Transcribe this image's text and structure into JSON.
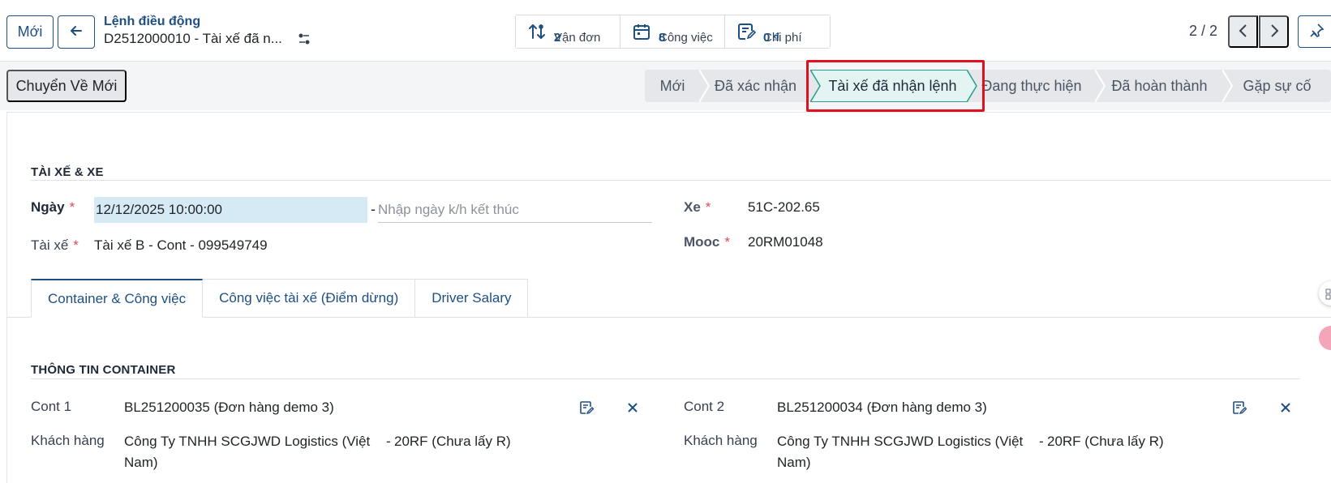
{
  "toolbar": {
    "new_label": "Mới"
  },
  "breadcrumb": {
    "parent": "Lệnh điều động",
    "record": "D2512000010 - Tài xế đã n..."
  },
  "smart_buttons": [
    {
      "label": "Vận đơn",
      "value": "2",
      "icon": "sort-arrows-icon"
    },
    {
      "label": "Công việc",
      "value": "8",
      "icon": "calendar-icon"
    },
    {
      "label": "Chi phí",
      "value": "0 ₫",
      "icon": "edit-note-icon"
    }
  ],
  "pager": {
    "text": "2 / 2"
  },
  "status": {
    "reset_label": "Chuyển Về Mới",
    "stages": [
      "Mới",
      "Đã xác nhận",
      "Tài xế đã nhận lệnh",
      "Đang thực hiện",
      "Đã hoàn thành",
      "Gặp sự cố"
    ],
    "active_stage": "Tài xế đã nhận lệnh"
  },
  "driver_section": {
    "title": "TÀI XẾ & XE",
    "date_label": "Ngày",
    "date_value": "12/12/2025 10:00:00",
    "date_end_placeholder": "Nhập ngày k/h kết thúc",
    "driver_label": "Tài xế",
    "driver_value": "Tài xế B - Cont - 099549749",
    "vehicle_label": "Xe",
    "vehicle_value": "51C-202.65",
    "trailer_label": "Mooc",
    "trailer_value": "20RM01048",
    "required_mark": "*"
  },
  "tabs": [
    "Container & Công việc",
    "Công việc tài xế (Điểm dừng)",
    "Driver Salary"
  ],
  "container_section": {
    "title": "THÔNG TIN CONTAINER",
    "cont1_label": "Cont 1",
    "cont1_value": "BL251200035 (Đơn hàng demo 3)",
    "cont2_label": "Cont 2",
    "cont2_value": "BL251200034 (Đơn hàng demo 3)",
    "customer_label": "Khách hàng",
    "customer1_line1": "Công Ty TNHH SCGJWD Logistics (Việt",
    "customer1_line2": "Nam)",
    "customer1_type": "20RF (Chưa lấy R)",
    "customer2_line1": "Công Ty TNHH SCGJWD Logistics (Việt",
    "customer2_line2": "Nam)",
    "customer2_type": "20RF (Chưa lấy R)",
    "dash": "-"
  },
  "colors": {
    "primary": "#1e4f82",
    "active_stage": "#2a9d8f",
    "highlight": "#e0101c"
  }
}
